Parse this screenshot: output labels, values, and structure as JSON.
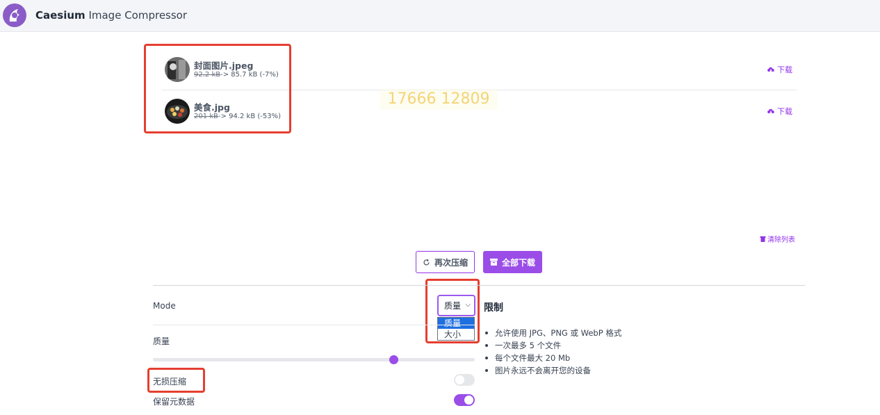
{
  "app": {
    "brand_bold": "Caesium",
    "brand_rest": " Image Compressor"
  },
  "files": [
    {
      "name": "封面图片.jpeg",
      "original_size": "92.2 kB",
      "compressed": "-> 85.7 kB (-7%)",
      "download_label": "下载"
    },
    {
      "name": "美食.jpg",
      "original_size": "201 kB",
      "compressed": "-> 94.2 kB (-53%)",
      "download_label": "下载"
    }
  ],
  "watermark": "17666 12809",
  "actions": {
    "clear_list": "清除列表",
    "recompress": "再次压缩",
    "download_all": "全部下载"
  },
  "settings": {
    "mode_label": "Mode",
    "mode_selected": "质量",
    "mode_options": [
      "质量",
      "大小"
    ],
    "quality_label": "质量",
    "quality_value_pct": 75,
    "lossless_label": "无损压缩",
    "lossless_on": false,
    "keep_metadata_label": "保留元数据",
    "keep_metadata_on": true
  },
  "limits": {
    "title": "限制",
    "items": [
      "允许使用 JPG、PNG 或 WebP 格式",
      "一次最多 5 个文件",
      "每个文件最大 20 Mb",
      "图片永远不会离开您的设备"
    ]
  },
  "colors": {
    "accent": "#9b4de8",
    "highlight_box": "#e53e2f",
    "dropdown_selected": "#1e6fe0"
  }
}
